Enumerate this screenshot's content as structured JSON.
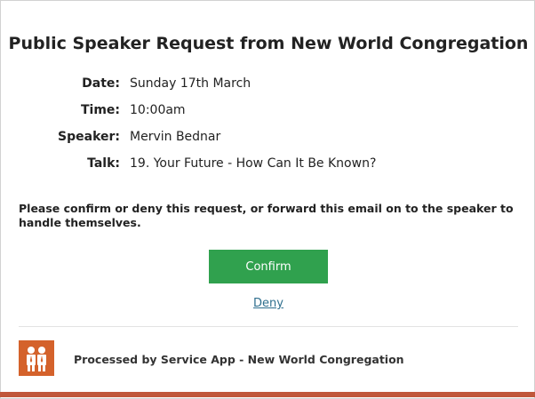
{
  "email": {
    "title": "Public Speaker Request from New World Congregation",
    "details": [
      {
        "label": "Date:",
        "value": "Sunday 17th March"
      },
      {
        "label": "Time:",
        "value": "10:00am"
      },
      {
        "label": "Speaker:",
        "value": "Mervin Bednar"
      },
      {
        "label": "Talk:",
        "value": "19. Your Future - How Can It Be Known?"
      }
    ],
    "instructions": "Please confirm or deny this request, or forward this email on to the speaker to handle themselves.",
    "confirm_label": "Confirm",
    "deny_label": "Deny",
    "footer_text": "Processed by Service App - New World Congregation"
  },
  "colors": {
    "confirm_button": "#30a14e",
    "link": "#2f6f8e",
    "logo_background": "#d4622b",
    "bottom_bar": "#c0573a"
  },
  "icons": {
    "logo": "people-pair-icon"
  }
}
